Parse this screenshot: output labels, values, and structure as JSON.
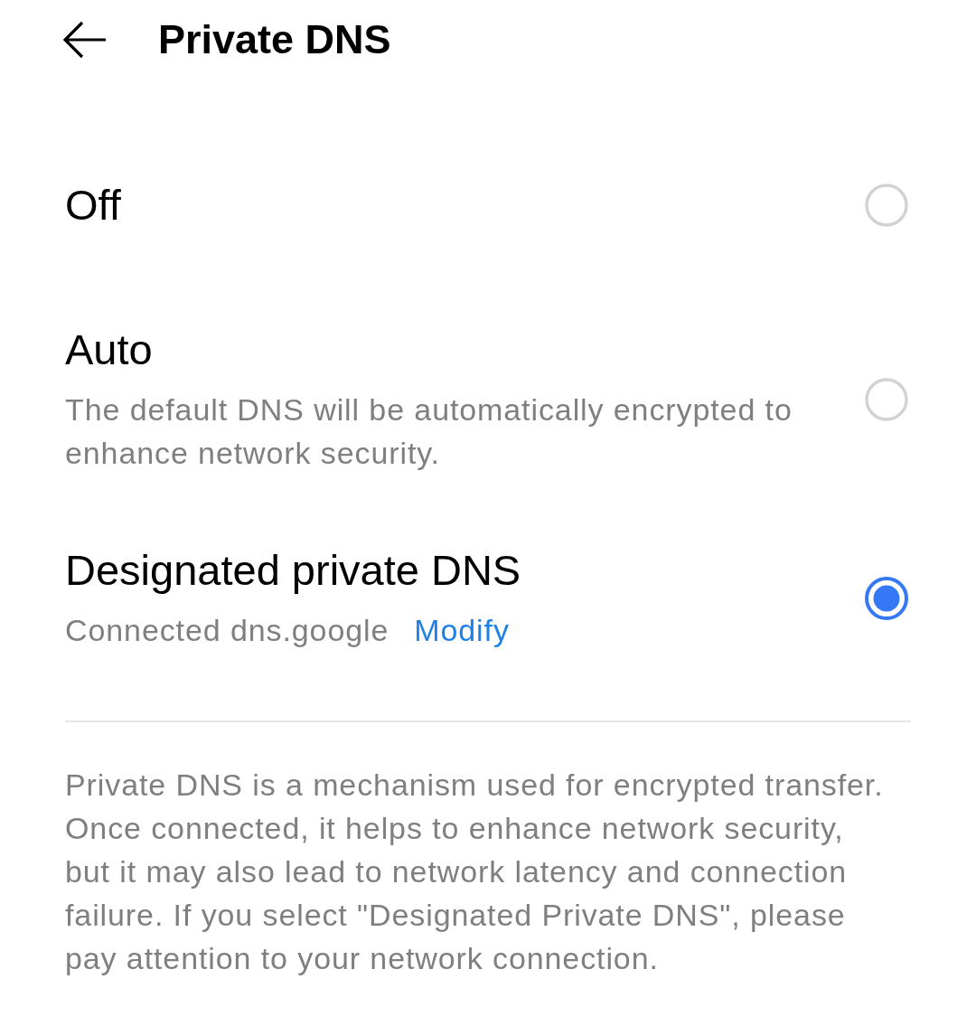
{
  "header": {
    "title": "Private DNS"
  },
  "options": [
    {
      "title": "Off",
      "selected": false
    },
    {
      "title": "Auto",
      "description": "The default DNS will be automatically encrypted to enhance network security.",
      "selected": false
    },
    {
      "title": "Designated private DNS",
      "status": "Connected dns.google",
      "action": "Modify",
      "selected": true
    }
  ],
  "footer_note": "Private DNS is a mechanism used for encrypted transfer. Once connected, it helps to enhance network security, but it may also lead to network latency and connection failure. If you select \"Designated Private DNS\", please pay attention to your network connection."
}
